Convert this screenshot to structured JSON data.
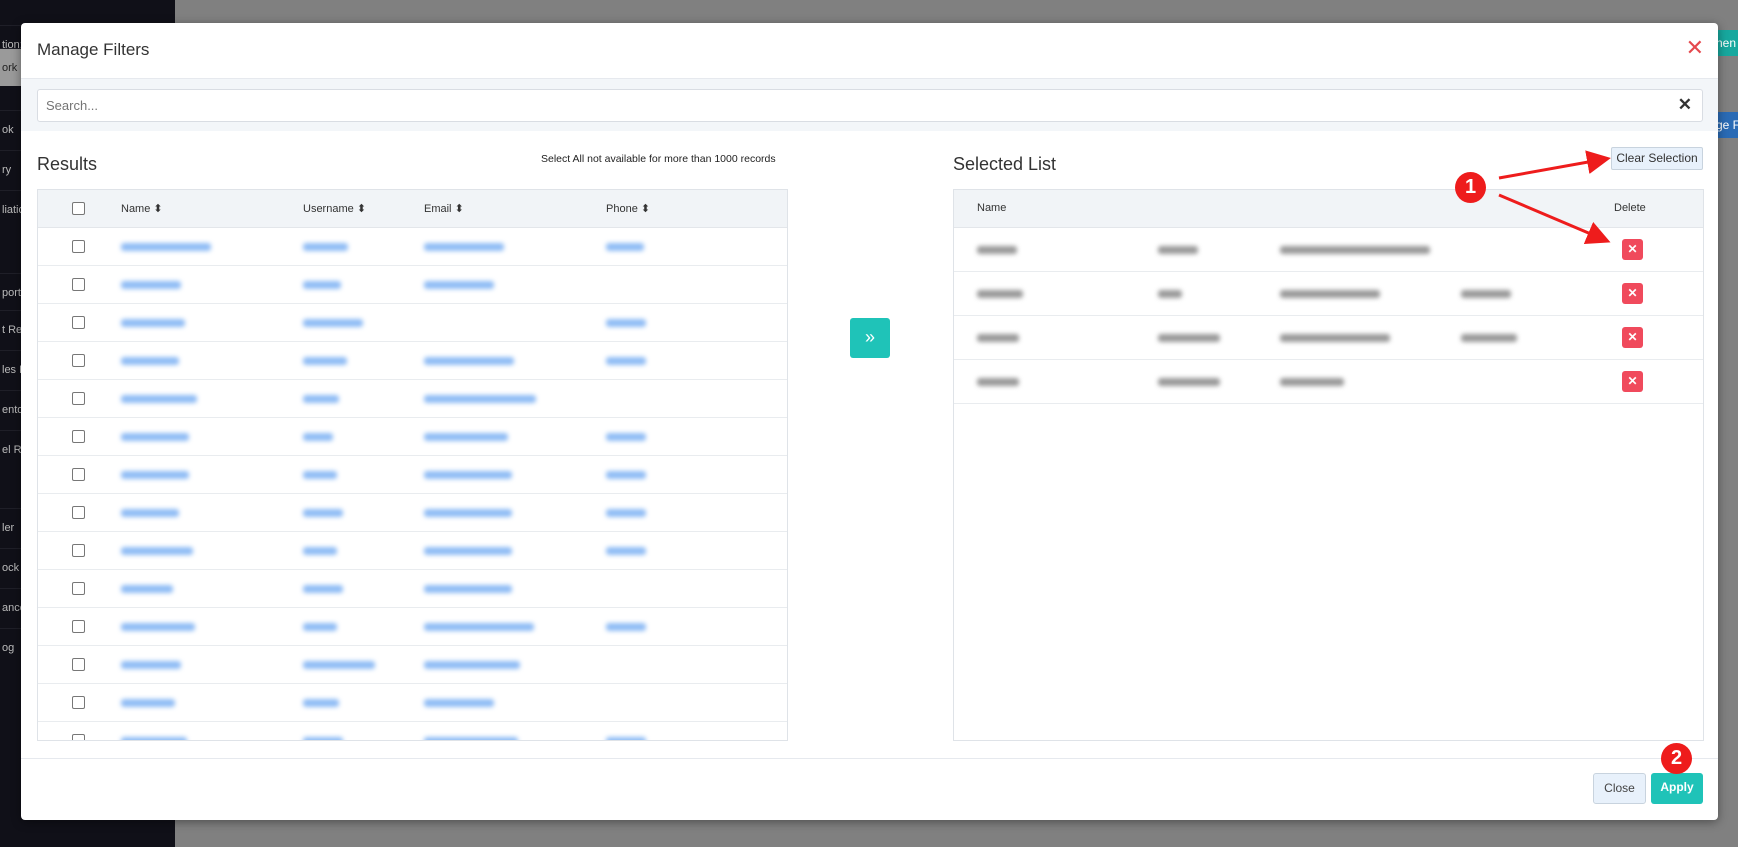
{
  "background": {
    "sidebar_items": [
      "tion:",
      "ork",
      "ok",
      "ry",
      "liatio",
      "port",
      "t Re",
      "les F",
      "ento",
      "el Re",
      "ler",
      "ock",
      "ance",
      "og"
    ],
    "top_button": "nen",
    "second_button": "ge F"
  },
  "modal": {
    "title": "Manage Filters",
    "search": {
      "placeholder": "Search...",
      "value": ""
    },
    "results": {
      "title": "Results",
      "note": "Select All not available for more than 1000 records",
      "columns": [
        "Name",
        "Username",
        "Email",
        "Phone"
      ],
      "row_count_visible": 14
    },
    "move_button_icon": "»",
    "selected": {
      "title": "Selected List",
      "clear_label": "Clear Selection",
      "columns": {
        "name": "Name",
        "delete": "Delete"
      },
      "row_count": 4
    },
    "footer": {
      "close_label": "Close",
      "apply_label": "Apply"
    }
  },
  "annotations": [
    "1",
    "2"
  ],
  "colors": {
    "accent": "#1fc3b8",
    "danger": "#f04a5c",
    "annotation": "#ee1c1c"
  }
}
